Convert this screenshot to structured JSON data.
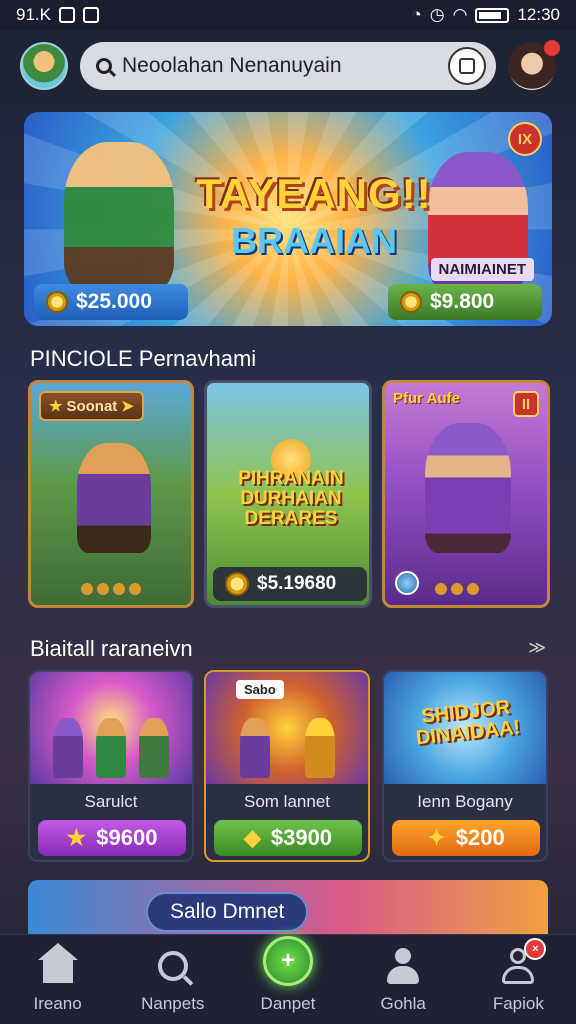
{
  "status_bar": {
    "left_text": "91.K",
    "time": "12:30"
  },
  "header": {
    "search_text": "Neoolahan Nenanuyain"
  },
  "hero": {
    "title": "TAYEANG!!",
    "subtitle": "BRAAIAN",
    "tag": "NAIMIAINET",
    "close_label": "IX",
    "price_left": "$25.000",
    "price_right": "$9.800"
  },
  "section1": {
    "title": "PINCIOLE Pernavhami",
    "cards": [
      {
        "ribbon": "Soonat"
      },
      {
        "title": "PIHRANAIN DURHAIAN DERARES",
        "price": "$5.19680"
      },
      {
        "tag": "Pfur Aufe",
        "close_label": "II"
      }
    ]
  },
  "section2": {
    "title": "Biaitall raraneivn",
    "more_label": "≫",
    "tiles": [
      {
        "name": "Sarulct",
        "price": "$9600",
        "icon": "star-icon"
      },
      {
        "label": "Sabo",
        "name": "Som lannet",
        "price": "$3900",
        "icon": "thumb-icon"
      },
      {
        "banner": "SHIDJOR DINAIDAA!",
        "name": "Ienn Bogany",
        "price": "$200",
        "icon": "diamond-icon"
      }
    ]
  },
  "promo": {
    "label": "Sallo Dmnet"
  },
  "bottom_nav": [
    {
      "label": "Ireano",
      "icon": "home-icon"
    },
    {
      "label": "Nanpets",
      "icon": "search-icon"
    },
    {
      "label": "Danpet",
      "icon": "play-icon"
    },
    {
      "label": "Gohla",
      "icon": "person-icon"
    },
    {
      "label": "Fapiok",
      "icon": "profile-icon"
    }
  ],
  "colors": {
    "accent_green": "#6fe04a",
    "badge_red": "#e53935",
    "gold": "#ffd23a"
  }
}
